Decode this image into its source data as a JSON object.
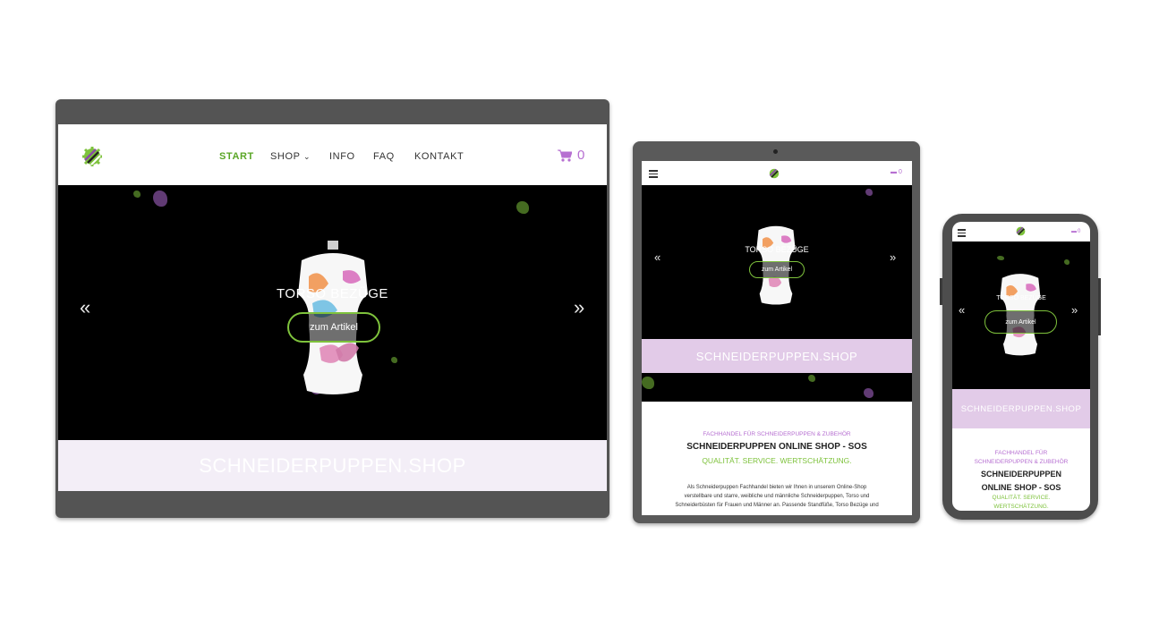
{
  "brand": {
    "logo": "sos-logo",
    "accent_green": "#7ec23c",
    "accent_purple": "#b66fd1",
    "dark": "#000000"
  },
  "nav": {
    "items": [
      "START",
      "SHOP",
      "INFO",
      "FAQ",
      "KONTAKT"
    ],
    "active": "START"
  },
  "cart": {
    "count": "0"
  },
  "hero": {
    "slide_title": "TORSO BEZÜGE",
    "cta_label": "zum Artikel",
    "prev_arrow": "«",
    "next_arrow": "»"
  },
  "banner": {
    "text": "SCHNEIDERPUPPEN.SHOP"
  },
  "intro": {
    "kicker": "FACHHANDEL FÜR SCHNEIDERPUPPEN & ZUBEHÖR",
    "kicker_line1": "FACHHANDEL FÜR",
    "kicker_line2": "SCHNEIDERPUPPEN & ZUBEHÖR",
    "heading": "SCHNEIDERPUPPEN ONLINE SHOP - SOS",
    "heading_line1": "SCHNEIDERPUPPEN",
    "heading_line2": "ONLINE SHOP - SOS",
    "tagline": "QUALITÄT. SERVICE. WERTSCHÄTZUNG.",
    "tagline_line1": "QUALITÄT. SERVICE.",
    "tagline_line2": "WERTSCHÄTZUNG.",
    "body_line1": "Als Schneiderpuppen Fachhandel bieten wir Ihnen in unserem Online-Shop",
    "body_line2": "verstellbare und starre, weibliche und männliche Schneiderpuppen, Torso und",
    "body_line3": "Schneiderbüsten für Frauen und Männer an. Passende Standfüße, Torso Bezüge und"
  }
}
